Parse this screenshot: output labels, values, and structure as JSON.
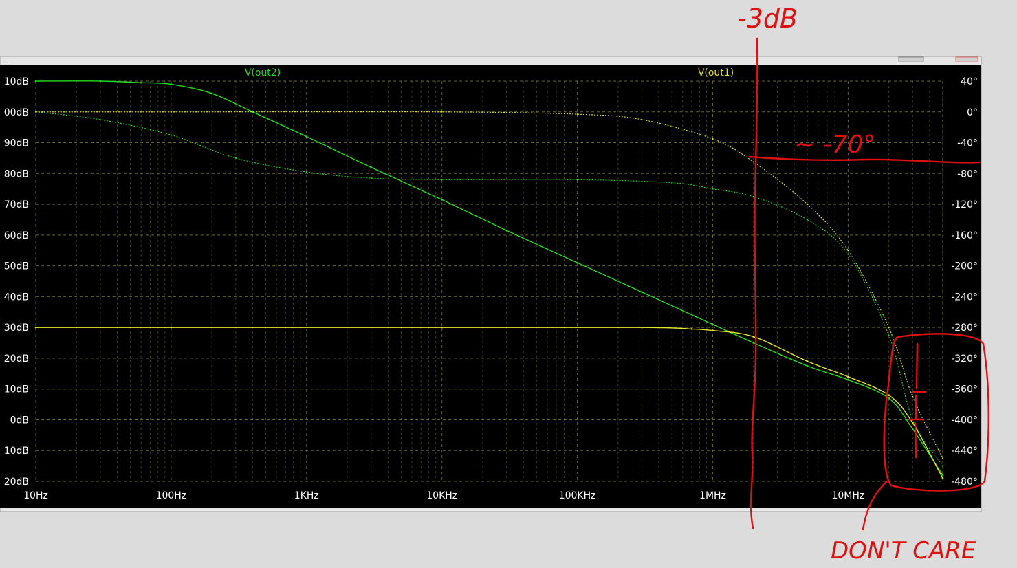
{
  "window": {
    "title_marker": "…"
  },
  "chart_data": {
    "type": "line",
    "x_scale": "log",
    "xlim": [
      10,
      50000000
    ],
    "y_left_lim": [
      -20,
      110
    ],
    "y_right_lim": [
      -480,
      40
    ],
    "x_ticks": [
      {
        "value": 10,
        "label": "10Hz"
      },
      {
        "value": 100,
        "label": "100Hz"
      },
      {
        "value": 1000,
        "label": "1KHz"
      },
      {
        "value": 10000,
        "label": "10KHz"
      },
      {
        "value": 100000,
        "label": "100KHz"
      },
      {
        "value": 1000000,
        "label": "1MHz"
      },
      {
        "value": 10000000,
        "label": "10MHz"
      }
    ],
    "y_left_ticks": [
      {
        "value": 110,
        "label": "10dB"
      },
      {
        "value": 100,
        "label": "00dB"
      },
      {
        "value": 90,
        "label": "90dB"
      },
      {
        "value": 80,
        "label": "80dB"
      },
      {
        "value": 70,
        "label": "70dB"
      },
      {
        "value": 60,
        "label": "60dB"
      },
      {
        "value": 50,
        "label": "50dB"
      },
      {
        "value": 40,
        "label": "40dB"
      },
      {
        "value": 30,
        "label": "30dB"
      },
      {
        "value": 20,
        "label": "20dB"
      },
      {
        "value": 10,
        "label": "10dB"
      },
      {
        "value": 0,
        "label": "0dB"
      },
      {
        "value": -10,
        "label": "10dB"
      },
      {
        "value": -20,
        "label": "20dB"
      }
    ],
    "y_right_ticks": [
      {
        "value": 40,
        "label": "40°"
      },
      {
        "value": 0,
        "label": "0°"
      },
      {
        "value": -40,
        "label": "-40°"
      },
      {
        "value": -80,
        "label": "-80°"
      },
      {
        "value": -120,
        "label": "-120°"
      },
      {
        "value": -160,
        "label": "-160°"
      },
      {
        "value": -200,
        "label": "-200°"
      },
      {
        "value": -240,
        "label": "-240°"
      },
      {
        "value": -280,
        "label": "-280°"
      },
      {
        "value": -320,
        "label": "-320°"
      },
      {
        "value": -360,
        "label": "-360°"
      },
      {
        "value": -400,
        "label": "-400°"
      },
      {
        "value": -440,
        "label": "-440°"
      },
      {
        "value": -480,
        "label": "-480°"
      }
    ],
    "grid": true,
    "series": [
      {
        "name": "V(out2)",
        "color": "#22dd22",
        "magnitude_db": [
          {
            "f": 10,
            "v": 110
          },
          {
            "f": 30,
            "v": 110
          },
          {
            "f": 60,
            "v": 109.5
          },
          {
            "f": 100,
            "v": 109
          },
          {
            "f": 200,
            "v": 106
          },
          {
            "f": 400,
            "v": 100
          },
          {
            "f": 1000,
            "v": 92
          },
          {
            "f": 3000,
            "v": 82
          },
          {
            "f": 10000,
            "v": 71.5
          },
          {
            "f": 30000,
            "v": 61.5
          },
          {
            "f": 100000,
            "v": 51
          },
          {
            "f": 300000,
            "v": 41.5
          },
          {
            "f": 1000000,
            "v": 31
          },
          {
            "f": 2000000,
            "v": 25
          },
          {
            "f": 5000000,
            "v": 17.5
          },
          {
            "f": 10000000,
            "v": 13
          },
          {
            "f": 20000000,
            "v": 7
          },
          {
            "f": 30000000,
            "v": -3
          },
          {
            "f": 50000000,
            "v": -18
          }
        ],
        "phase_deg": [
          {
            "f": 10,
            "v": 0
          },
          {
            "f": 30,
            "v": -10
          },
          {
            "f": 100,
            "v": -30
          },
          {
            "f": 300,
            "v": -60
          },
          {
            "f": 1000,
            "v": -78
          },
          {
            "f": 3000,
            "v": -86
          },
          {
            "f": 10000,
            "v": -88
          },
          {
            "f": 100000,
            "v": -88
          },
          {
            "f": 500000,
            "v": -92
          },
          {
            "f": 1000000,
            "v": -100
          },
          {
            "f": 2000000,
            "v": -110
          },
          {
            "f": 5000000,
            "v": -140
          },
          {
            "f": 10000000,
            "v": -185
          },
          {
            "f": 20000000,
            "v": -290
          },
          {
            "f": 30000000,
            "v": -400
          },
          {
            "f": 50000000,
            "v": -460
          }
        ]
      },
      {
        "name": "V(out1)",
        "color": "#e6e62a",
        "magnitude_db": [
          {
            "f": 10,
            "v": 30
          },
          {
            "f": 100,
            "v": 30
          },
          {
            "f": 10000,
            "v": 30
          },
          {
            "f": 300000,
            "v": 30
          },
          {
            "f": 700000,
            "v": 29.5
          },
          {
            "f": 1000000,
            "v": 29
          },
          {
            "f": 2000000,
            "v": 27
          },
          {
            "f": 5000000,
            "v": 19
          },
          {
            "f": 10000000,
            "v": 14
          },
          {
            "f": 20000000,
            "v": 8
          },
          {
            "f": 30000000,
            "v": -1
          },
          {
            "f": 50000000,
            "v": -19
          }
        ],
        "phase_deg": [
          {
            "f": 10,
            "v": 0
          },
          {
            "f": 100,
            "v": 0
          },
          {
            "f": 10000,
            "v": 0
          },
          {
            "f": 100000,
            "v": -3
          },
          {
            "f": 300000,
            "v": -10
          },
          {
            "f": 1000000,
            "v": -35
          },
          {
            "f": 2000000,
            "v": -65
          },
          {
            "f": 5000000,
            "v": -120
          },
          {
            "f": 10000000,
            "v": -180
          },
          {
            "f": 20000000,
            "v": -280
          },
          {
            "f": 30000000,
            "v": -370
          },
          {
            "f": 50000000,
            "v": -450
          }
        ]
      }
    ],
    "annotations": {
      "minus3db": "-3dB",
      "phase_note": "~ -70°",
      "dont_care": "DON'T CARE"
    }
  }
}
